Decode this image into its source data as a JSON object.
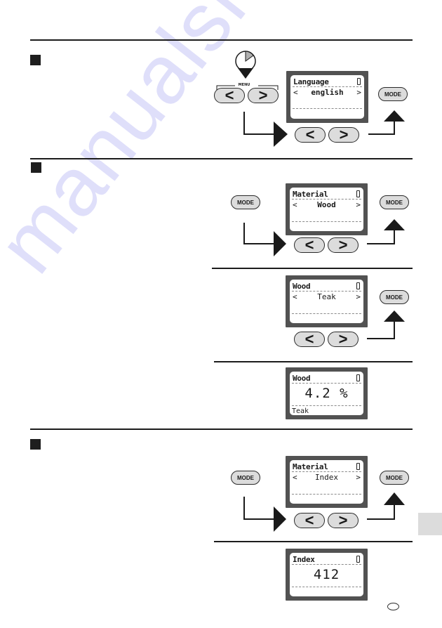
{
  "watermark": "manualshive.com",
  "menu_label": "MENU",
  "buttons": {
    "left": "<",
    "right": ">",
    "mode": "MODE"
  },
  "sections": [
    {
      "screen": {
        "title": "Language",
        "value": "english",
        "prev": "<",
        "next": ">"
      }
    },
    {
      "screen_material": {
        "title": "Material",
        "value": "Wood",
        "prev": "<",
        "next": ">"
      },
      "screen_type": {
        "title": "Wood",
        "value": "Teak",
        "prev": "<",
        "next": ">"
      },
      "screen_result": {
        "title": "Wood",
        "reading": "4.2 %",
        "footer": "Teak"
      }
    },
    {
      "screen_material": {
        "title": "Material",
        "value": "Index",
        "prev": "<",
        "next": ">"
      },
      "screen_result": {
        "title": "Index",
        "reading": "412"
      }
    }
  ],
  "colors": {
    "bezel": "#525252",
    "button_fill": "#dcdcdc",
    "timer_wedge": "#b0b0b0",
    "side_tab": "#dcdcdc"
  }
}
